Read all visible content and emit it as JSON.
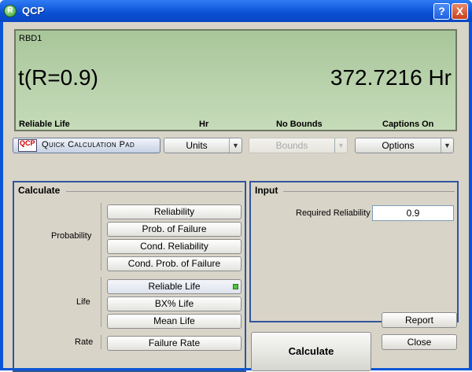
{
  "window": {
    "title": "QCP",
    "help_label": "?",
    "close_label": "X",
    "app_icon": "qcp-app-icon"
  },
  "display": {
    "model_name": "RBD1",
    "function": "t(R=0.9)",
    "result": "372.7216 Hr",
    "footer": {
      "mode": "Reliable Life",
      "units": "Hr",
      "bounds": "No Bounds",
      "captions": "Captions On"
    }
  },
  "toolbar": {
    "qcp_icon_text": "QCP",
    "qcp_label": "Quick Calculation Pad",
    "units_label": "Units",
    "bounds_label": "Bounds",
    "options_label": "Options",
    "dropdown_glyph": "▼"
  },
  "calculate": {
    "title": "Calculate",
    "groups": {
      "probability": "Probability",
      "life": "Life",
      "rate": "Rate"
    },
    "buttons": {
      "reliability": "Reliability",
      "prob_failure": "Prob. of Failure",
      "cond_reliability": "Cond. Reliability",
      "cond_prob_failure": "Cond. Prob. of Failure",
      "reliable_life": "Reliable Life",
      "bx_life": "BX% Life",
      "mean_life": "Mean Life",
      "failure_rate": "Failure Rate"
    },
    "selected": "reliable_life"
  },
  "input": {
    "title": "Input",
    "required_reliability_label": "Required Reliability",
    "required_reliability_value": "0.9"
  },
  "actions": {
    "calculate": "Calculate",
    "report": "Report",
    "close": "Close"
  },
  "colors": {
    "title_bar": "#0a4fd3",
    "lcd_background": "#b9d2ac",
    "panel_border": "#32559a",
    "selected_indicator": "#4fc23e"
  }
}
